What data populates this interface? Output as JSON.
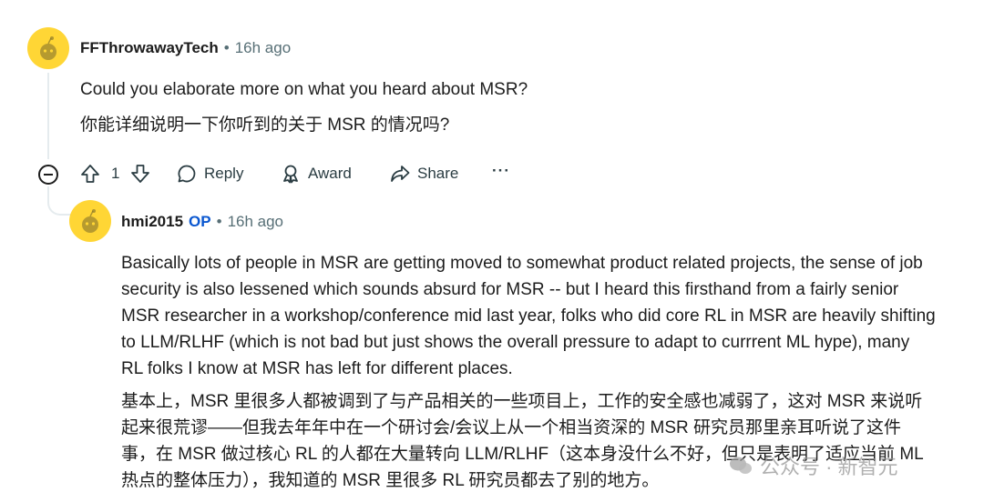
{
  "comment1": {
    "username": "FFThrowawayTech",
    "separator": "•",
    "time": "16h ago",
    "text_en": "Could you elaborate more on what you heard about MSR?",
    "text_zh": "你能详细说明一下你听到的关于 MSR 的情况吗?",
    "votes": "1",
    "reply_label": "Reply",
    "award_label": "Award",
    "share_label": "Share",
    "more_label": "···"
  },
  "comment2": {
    "username": "hmi2015",
    "op_badge": "OP",
    "separator": "•",
    "time": "16h ago",
    "text_en_lines": [
      "Basically lots of people in MSR are getting moved to somewhat product related projects, the sense of job",
      "security is also lessened which sounds absurd for MSR -- but I heard this firsthand from a fairly senior",
      "MSR researcher in a workshop/conference mid last year, folks who did core RL in MSR are heavily shifting",
      "to LLM/RLHF (which is not bad but just shows the overall pressure to adapt to currrent ML hype), many",
      "RL folks I know at MSR has left for different places."
    ],
    "text_zh_lines": [
      "基本上，MSR 里很多人都被调到了与产品相关的一些项目上，工作的安全感也减弱了，这对 MSR 来说听",
      "起来很荒谬——但我去年年中在一个研讨会/会议上从一个相当资深的 MSR 研究员那里亲耳听说了这件",
      "事，在 MSR 做过核心 RL 的人都在大量转向 LLM/RLHF（这本身没什么不好，但只是表明了适应当前 ML",
      "热点的整体压力），我知道的 MSR 里很多 RL 研究员都去了别的地方。"
    ]
  },
  "watermark": {
    "text": "公众号 · 新智元"
  },
  "colors": {
    "avatar": "#ffd635",
    "op": "#0a57d0",
    "meta": "#576f76",
    "line": "#e5ebee"
  }
}
